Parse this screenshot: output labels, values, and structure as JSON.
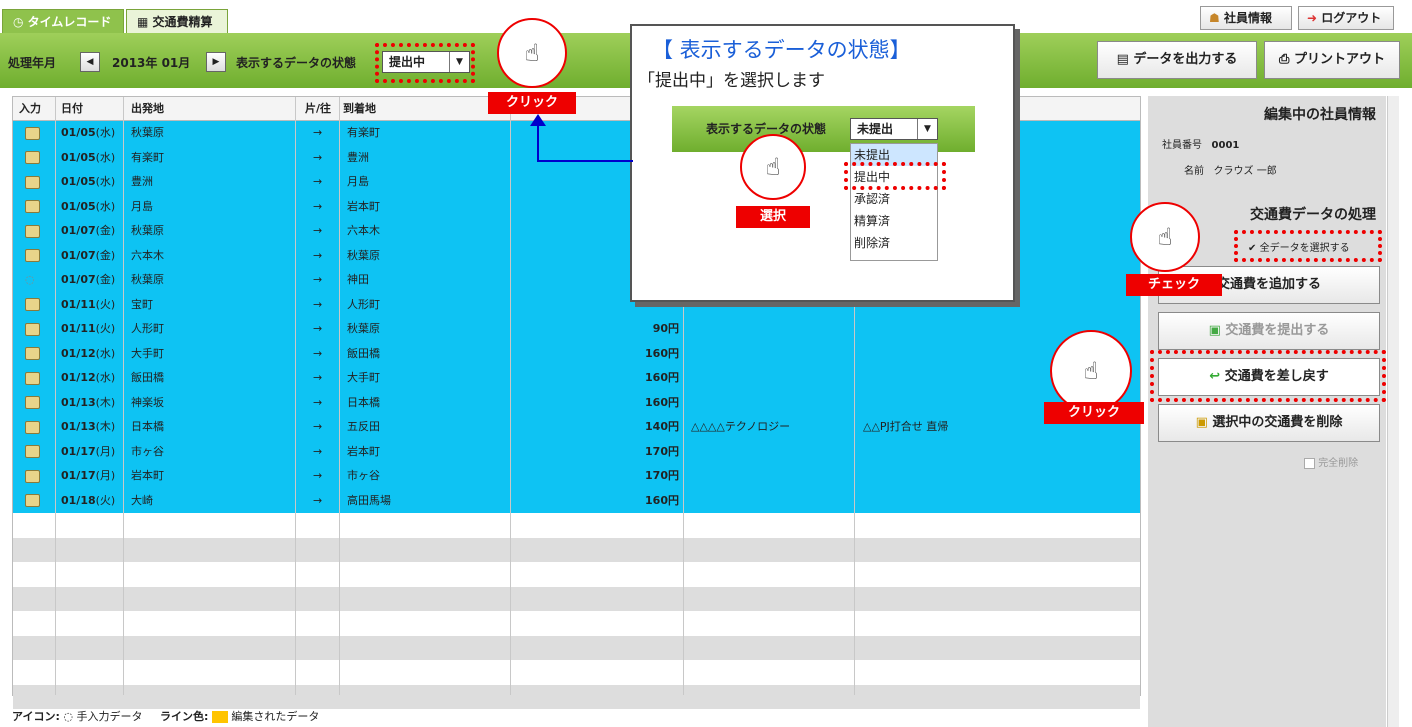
{
  "tabs": [
    {
      "label": "タイムレコード"
    },
    {
      "label": "交通費精算"
    }
  ],
  "header": {
    "employee_info": "社員情報",
    "logout": "ログアウト"
  },
  "toolbar": {
    "period_label": "処理年月",
    "period_value": "2013年 01月",
    "status_label": "表示するデータの状態",
    "status_value": "提出中",
    "export": "データを出力する",
    "print": "プリントアウト",
    "prev_icon": "◀",
    "next_icon": "▶",
    "arrow": "▼"
  },
  "columns": [
    "入力",
    "日付",
    "出発地",
    "片/往",
    "到着地"
  ],
  "rows": [
    {
      "date": "01/05",
      "dow": "(水)",
      "from": "秋葉原",
      "arrow": "→",
      "to": "有楽町",
      "fare": "",
      "company": "",
      "note": ""
    },
    {
      "date": "01/05",
      "dow": "(水)",
      "from": "有楽町",
      "arrow": "→",
      "to": "豊洲",
      "fare": "",
      "company": "",
      "note": ""
    },
    {
      "date": "01/05",
      "dow": "(水)",
      "from": "豊洲",
      "arrow": "→",
      "to": "月島",
      "fare": "",
      "company": "",
      "note": ""
    },
    {
      "date": "01/05",
      "dow": "(水)",
      "from": "月島",
      "arrow": "→",
      "to": "岩本町",
      "fare": "",
      "company": "",
      "note": ""
    },
    {
      "date": "01/07",
      "dow": "(金)",
      "from": "秋葉原",
      "arrow": "→",
      "to": "六本木",
      "fare": "",
      "company": "",
      "note": ""
    },
    {
      "date": "01/07",
      "dow": "(金)",
      "from": "六本木",
      "arrow": "→",
      "to": "秋葉原",
      "fare": "",
      "company": "",
      "note": ""
    },
    {
      "date": "01/07",
      "dow": "(金)",
      "from": "秋葉原",
      "arrow": "→",
      "to": "神田",
      "fare": "",
      "company": "",
      "note": ""
    },
    {
      "date": "01/11",
      "dow": "(火)",
      "from": "宝町",
      "arrow": "→",
      "to": "人形町",
      "fare": "",
      "company": "",
      "note": ""
    },
    {
      "date": "01/11",
      "dow": "(火)",
      "from": "人形町",
      "arrow": "→",
      "to": "秋葉原",
      "fare": "90円",
      "company": "",
      "note": ""
    },
    {
      "date": "01/12",
      "dow": "(水)",
      "from": "大手町",
      "arrow": "→",
      "to": "飯田橋",
      "fare": "160円",
      "company": "",
      "note": ""
    },
    {
      "date": "01/12",
      "dow": "(水)",
      "from": "飯田橋",
      "arrow": "→",
      "to": "大手町",
      "fare": "160円",
      "company": "",
      "note": ""
    },
    {
      "date": "01/13",
      "dow": "(木)",
      "from": "神楽坂",
      "arrow": "→",
      "to": "日本橋",
      "fare": "160円",
      "company": "",
      "note": ""
    },
    {
      "date": "01/13",
      "dow": "(木)",
      "from": "日本橋",
      "arrow": "→",
      "to": "五反田",
      "fare": "140円",
      "company": "△△△△テクノロジー",
      "note": "△△PJ打合せ 直帰"
    },
    {
      "date": "01/17",
      "dow": "(月)",
      "from": "市ヶ谷",
      "arrow": "→",
      "to": "岩本町",
      "fare": "170円",
      "company": "",
      "note": ""
    },
    {
      "date": "01/17",
      "dow": "(月)",
      "from": "岩本町",
      "arrow": "→",
      "to": "市ヶ谷",
      "fare": "170円",
      "company": "",
      "note": ""
    },
    {
      "date": "01/18",
      "dow": "(火)",
      "from": "大崎",
      "arrow": "→",
      "to": "高田馬場",
      "fare": "160円",
      "company": "",
      "note": ""
    }
  ],
  "legend": {
    "icon_label": "アイコン:",
    "icon_text": "手入力データ",
    "line_label": "ライン色:",
    "line_text": "編集されたデータ"
  },
  "panel": {
    "title": "編集中の社員情報",
    "emp_no_label": "社員番号",
    "emp_no": "0001",
    "name_label": "名前",
    "name": "クラウズ 一郎",
    "section": "交通費データの処理",
    "select_all": "全データを選択する",
    "add": "交通費を追加する",
    "submit": "交通費を提出する",
    "revert": "交通費を差し戻す",
    "delete": "選択中の交通費を削除",
    "full_delete": "完全削除"
  },
  "popup": {
    "title": "【 表示するデータの状態】",
    "subtitle": "「提出中」を選択します",
    "label": "表示するデータの状態",
    "current": "未提出",
    "options": [
      "未提出",
      "提出中",
      "承認済",
      "精算済",
      "削除済"
    ]
  },
  "callouts": {
    "click1": "クリック",
    "select": "選択",
    "check": "チェック",
    "click2": "クリック"
  },
  "colors": {
    "green": "#8fc24c",
    "selected_row": "#0ec3f3",
    "callout": "#e00000",
    "popup_title": "#1a5fd8"
  }
}
